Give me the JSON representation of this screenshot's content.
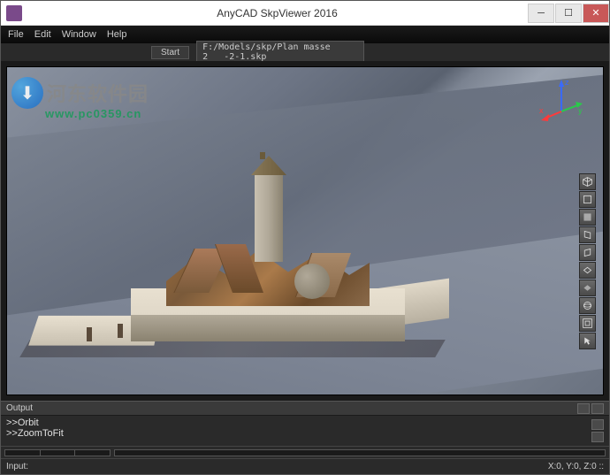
{
  "titlebar": {
    "title": "AnyCAD SkpViewer 2016"
  },
  "menubar": {
    "items": [
      "File",
      "Edit",
      "Window",
      "Help"
    ]
  },
  "toolbar": {
    "start_label": "Start",
    "path_value": "F:/Models/skp/Plan masse 2___-2-1.skp"
  },
  "axis": {
    "x": "x",
    "y": "y",
    "z": "z"
  },
  "view_tools": [
    {
      "name": "view-iso-icon"
    },
    {
      "name": "view-front-icon"
    },
    {
      "name": "view-back-icon"
    },
    {
      "name": "view-left-icon"
    },
    {
      "name": "view-right-icon"
    },
    {
      "name": "view-top-icon"
    },
    {
      "name": "view-bottom-icon"
    },
    {
      "name": "orbit-icon"
    },
    {
      "name": "fit-icon"
    },
    {
      "name": "pointer-icon"
    }
  ],
  "output": {
    "title": "Output",
    "lines": [
      ">>Orbit",
      ">>ZoomToFit"
    ]
  },
  "statusbar": {
    "input_label": "Input:",
    "coords": "X:0, Y:0, Z:0  ::"
  },
  "watermark": {
    "text": "河东软件园",
    "url": "www.pc0359.cn"
  }
}
